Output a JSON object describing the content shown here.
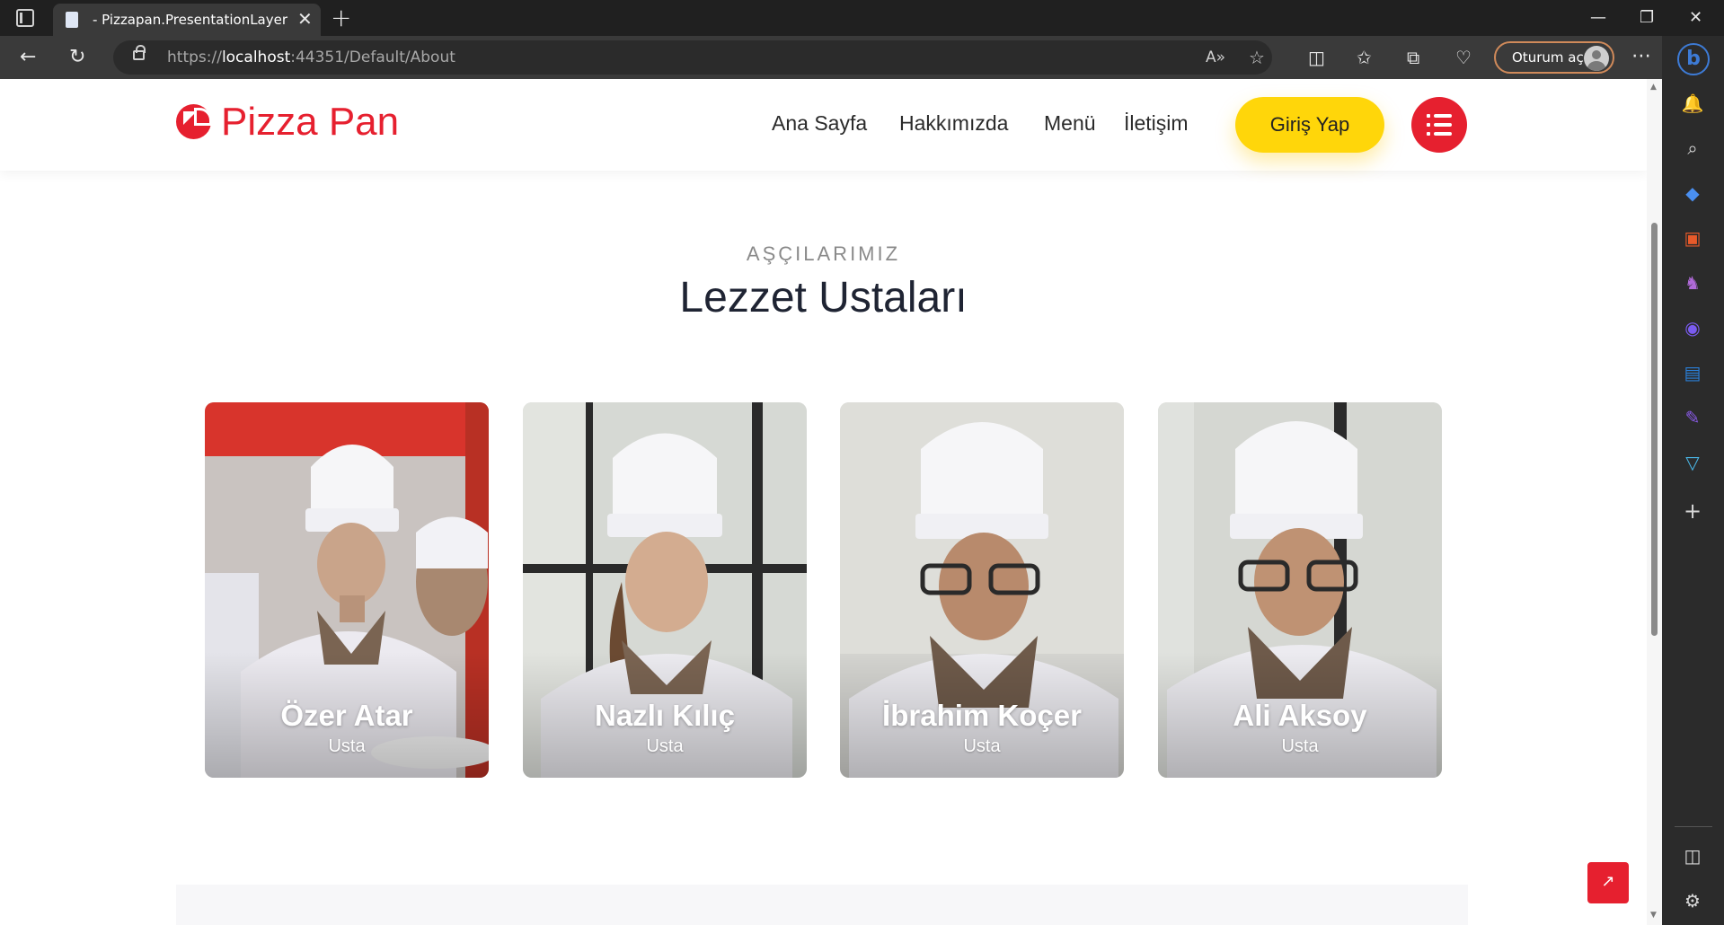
{
  "browser": {
    "tab_title": "- Pizzapan.PresentationLayer",
    "url_scheme": "https://",
    "url_host": "localhost",
    "url_rest": ":44351/Default/About",
    "signin_label": "Oturum aç"
  },
  "site": {
    "logo_text": "Pizza Pan",
    "nav": [
      "Ana Sayfa",
      "Hakkımızda",
      "Menü",
      "İletişim"
    ],
    "login_label": "Giriş Yap"
  },
  "team": {
    "subtitle": "AŞÇILARIMIZ",
    "title": "Lezzet Ustaları",
    "chefs": [
      {
        "name": "Özer Atar",
        "role": "Usta"
      },
      {
        "name": "Nazlı Kılıç",
        "role": "Usta"
      },
      {
        "name": "İbrahim Koçer",
        "role": "Usta"
      },
      {
        "name": "Ali Aksoy",
        "role": "Usta"
      }
    ]
  },
  "colors": {
    "brand_red": "#e6202f",
    "brand_yellow": "#ffd60a",
    "title_dark": "#1f2433"
  },
  "icons": {
    "logo": "pie-chart-icon",
    "menu": "list-icon",
    "back_to_top": "arrow-up-icon"
  }
}
